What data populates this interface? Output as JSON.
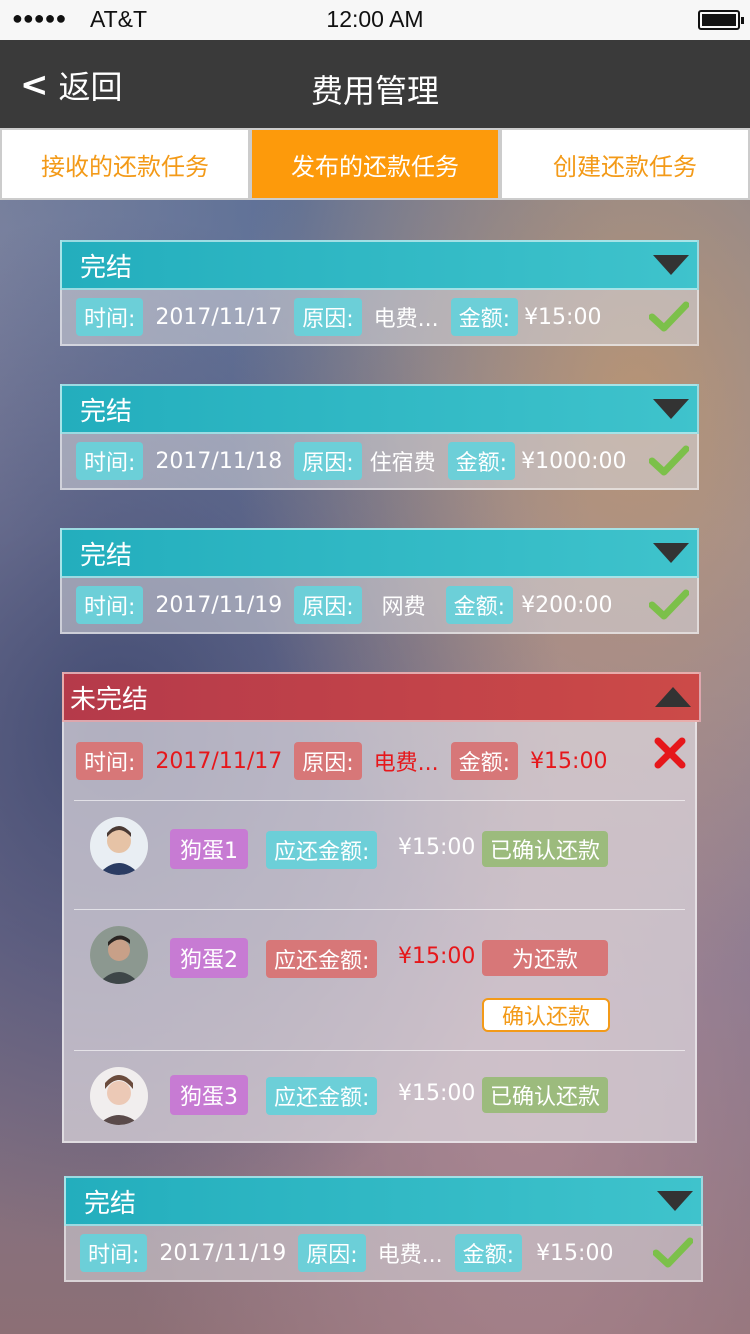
{
  "status_bar": {
    "signal": "●●●●●",
    "carrier": "AT&T",
    "time": "12:00 AM"
  },
  "nav": {
    "back_label": "返回",
    "title": "费用管理"
  },
  "tabs": [
    {
      "label": "接收的还款任务",
      "active": false
    },
    {
      "label": "发布的还款任务",
      "active": true
    },
    {
      "label": "创建还款任务",
      "active": false
    }
  ],
  "labels": {
    "time": "时间:",
    "reason": "原因:",
    "amount": "金额:",
    "due": "应还金额:"
  },
  "records": [
    {
      "status": "完结",
      "time": "2017/11/17",
      "reason": "电费...",
      "amount": "¥15:00",
      "icon": "check-icon"
    },
    {
      "status": "完结",
      "time": "2017/11/18",
      "reason": "住宿费",
      "amount": "¥1000:00",
      "icon": "check-icon"
    },
    {
      "status": "完结",
      "time": "2017/11/19",
      "reason": "网费",
      "amount": "¥200:00",
      "icon": "check-icon"
    },
    {
      "status": "未完结",
      "time": "2017/11/17",
      "reason": "电费...",
      "amount": "¥15:00",
      "icon": "cross-icon"
    },
    {
      "status": "完结",
      "time": "2017/11/19",
      "reason": "电费...",
      "amount": "¥15:00",
      "icon": "check-icon"
    }
  ],
  "payers": [
    {
      "name": "狗蛋1",
      "due": "¥15:00",
      "state": "已确认还款"
    },
    {
      "name": "狗蛋2",
      "due": "¥15:00",
      "state": "为还款",
      "action": "确认还款"
    },
    {
      "name": "狗蛋3",
      "due": "¥15:00",
      "state": "已确认还款"
    }
  ],
  "colors": {
    "accent": "#fd9a0b",
    "done_header": "#23aebd",
    "pending_header": "#c24148",
    "tag": "#6ccfd8",
    "name_tag": "#c77bd3",
    "confirmed": "#9cbb7d",
    "unpaid": "#d77778",
    "check": "#7cc04a",
    "cross": "#e6171b"
  }
}
